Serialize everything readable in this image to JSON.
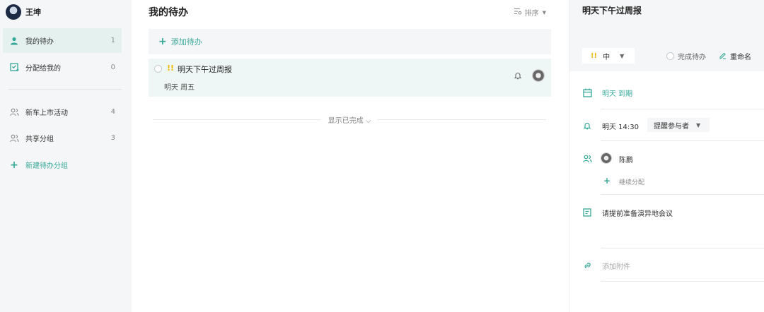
{
  "user": {
    "name": "王坤"
  },
  "sidebar": {
    "items": [
      {
        "label": "我的待办",
        "count": "1"
      },
      {
        "label": "分配给我的",
        "count": "0"
      },
      {
        "label": "新车上市活动",
        "count": "4"
      },
      {
        "label": "共享分组",
        "count": "3"
      }
    ],
    "add_group": "新建待办分组"
  },
  "main": {
    "title": "我的待办",
    "sort_label": "排序",
    "add_todo": "添加待办",
    "todo": {
      "priority": "!!",
      "title": "明天下午过周报",
      "due": "明天 周五"
    },
    "show_done": "显示已完成"
  },
  "detail": {
    "title": "明天下午过周报",
    "priority_mark": "!!",
    "priority_value": "中",
    "complete_label": "完成待办",
    "rename_label": "重命名",
    "due": "明天 到期",
    "remind_time": "明天 14:30",
    "remind_select": "提醒参与者",
    "assignee": "陈鹏",
    "continue_assign": "继续分配",
    "note": "请提前准备演异地会议",
    "attachment": "添加附件"
  },
  "colors": {
    "accent": "#35a898",
    "priority": "#f0b800",
    "active_bg": "#e4f1ef",
    "panel_bg": "#f5f6f7"
  }
}
